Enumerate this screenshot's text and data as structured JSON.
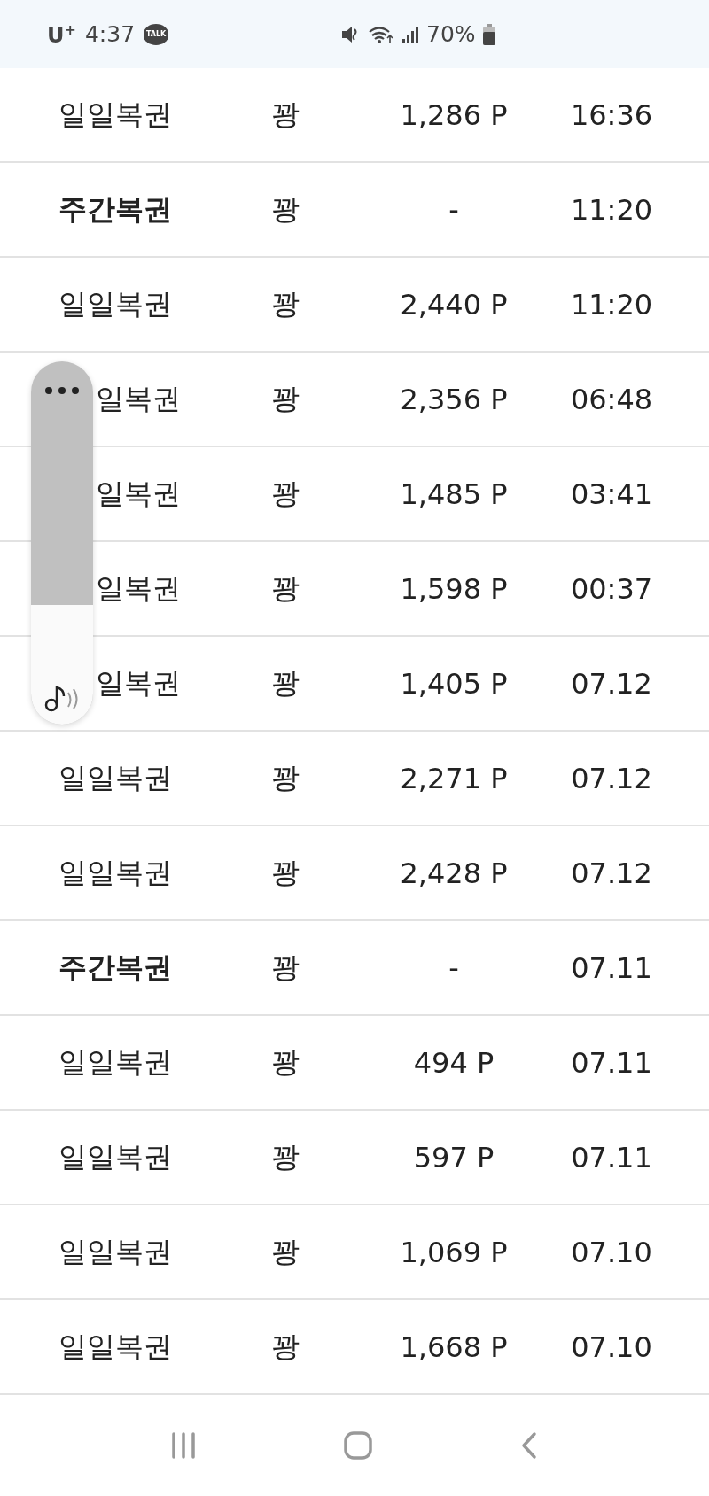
{
  "status_bar": {
    "carrier": "U$^{+}$",
    "time": "4:37",
    "chat_badge": "TALK",
    "battery_percent": "70%"
  },
  "rows": [
    {
      "kind": "daily",
      "name": "일일복권",
      "result": "꽝",
      "points": "1,286 P",
      "time": "16:36"
    },
    {
      "kind": "weekly",
      "name": "주간복권",
      "result": "꽝",
      "points": "-",
      "time": "11:20"
    },
    {
      "kind": "daily",
      "name": "일일복권",
      "result": "꽝",
      "points": "2,440 P",
      "time": "11:20"
    },
    {
      "kind": "daily",
      "name": "일복권",
      "covered": true,
      "result": "꽝",
      "points": "2,356 P",
      "time": "06:48"
    },
    {
      "kind": "daily",
      "name": "일복권",
      "covered": true,
      "result": "꽝",
      "points": "1,485 P",
      "time": "03:41"
    },
    {
      "kind": "daily",
      "name": "일복권",
      "covered": true,
      "result": "꽝",
      "points": "1,598 P",
      "time": "00:37"
    },
    {
      "kind": "daily",
      "name": "일복권",
      "covered": true,
      "result": "꽝",
      "points": "1,405 P",
      "time": "07.12"
    },
    {
      "kind": "daily",
      "name": "일일복권",
      "result": "꽝",
      "points": "2,271 P",
      "time": "07.12"
    },
    {
      "kind": "daily",
      "name": "일일복권",
      "result": "꽝",
      "points": "2,428 P",
      "time": "07.12"
    },
    {
      "kind": "weekly",
      "name": "주간복권",
      "result": "꽝",
      "points": "-",
      "time": "07.11"
    },
    {
      "kind": "daily",
      "name": "일일복권",
      "result": "꽝",
      "points": "494 P",
      "time": "07.11"
    },
    {
      "kind": "daily",
      "name": "일일복권",
      "result": "꽝",
      "points": "597 P",
      "time": "07.11"
    },
    {
      "kind": "daily",
      "name": "일일복권",
      "result": "꽝",
      "points": "1,069 P",
      "time": "07.10"
    },
    {
      "kind": "daily",
      "name": "일일복권",
      "result": "꽝",
      "points": "1,668 P",
      "time": "07.10"
    }
  ],
  "volume_panel": {
    "level": 0.33
  }
}
